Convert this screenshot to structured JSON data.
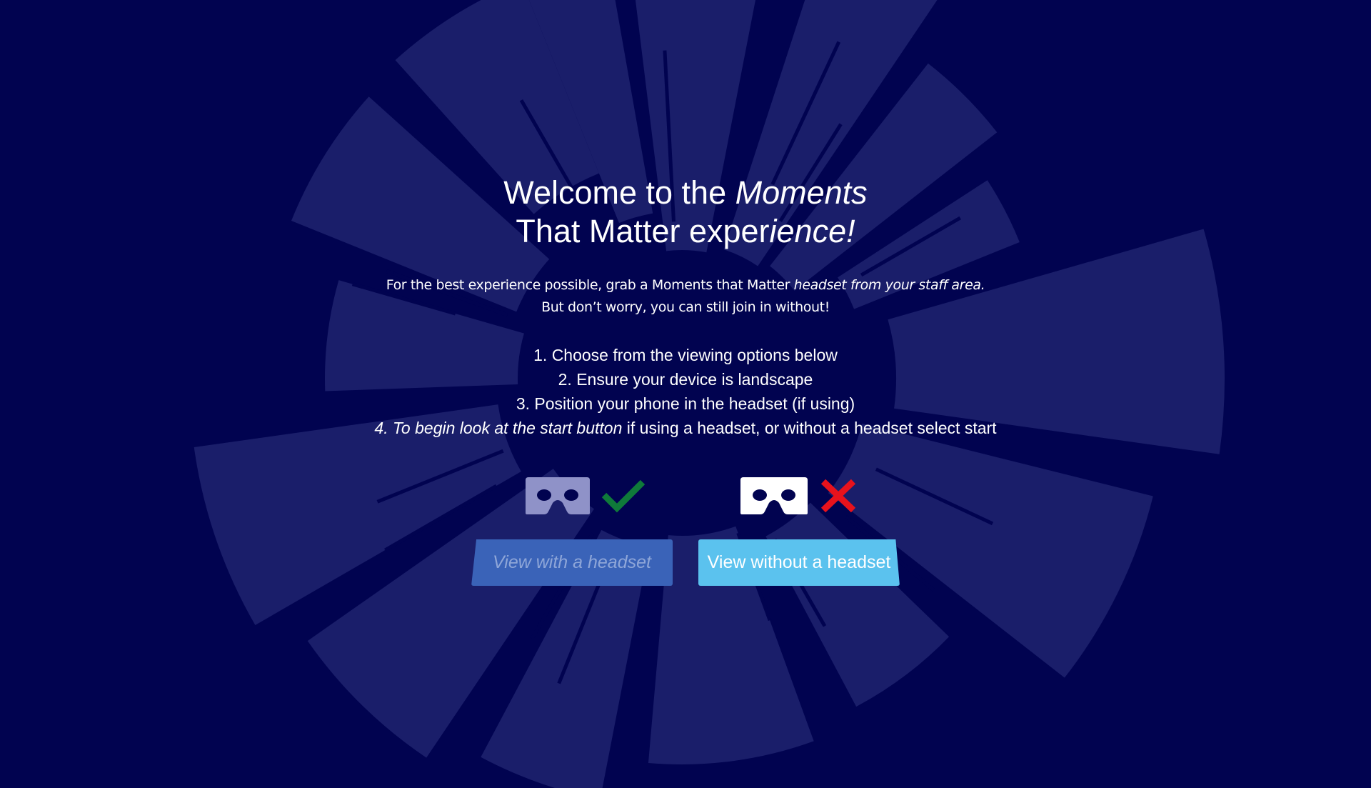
{
  "welcome": {
    "title_line1_a": "Welcome to the ",
    "title_line1_b": "Moments",
    "title_line2_a": "That Matter exper",
    "title_line2_b": "ience!",
    "subtitle_line1_a": "For the best experience possible, grab a Moments that Matter ",
    "subtitle_line1_b": "headset from your staff area.",
    "subtitle_line2": "But don’t worry, you can still join in without!"
  },
  "steps": {
    "step1": "1. Choose from the viewing options below",
    "step2": "2. Ensure your device is landscape",
    "step3": "3. Position your phone in the headset (if using)",
    "step4_a": "4. To begin look at the start button",
    "step4_b": " if using a headset, or without a headset select start"
  },
  "options": {
    "with_headset": {
      "label": "View with a headset",
      "headset_icon": "vr-headset-icon",
      "status_icon": "checkmark-icon",
      "status_color": "#0f7a3a"
    },
    "without_headset": {
      "label": "View without a headset",
      "headset_icon": "vr-headset-icon",
      "status_icon": "cross-icon",
      "status_color": "#e8121c"
    }
  },
  "colors": {
    "background": "#010350",
    "decoration": "#1a1e6a",
    "button_active": "#5bc2ee",
    "button_inactive": "#3a63b8"
  }
}
